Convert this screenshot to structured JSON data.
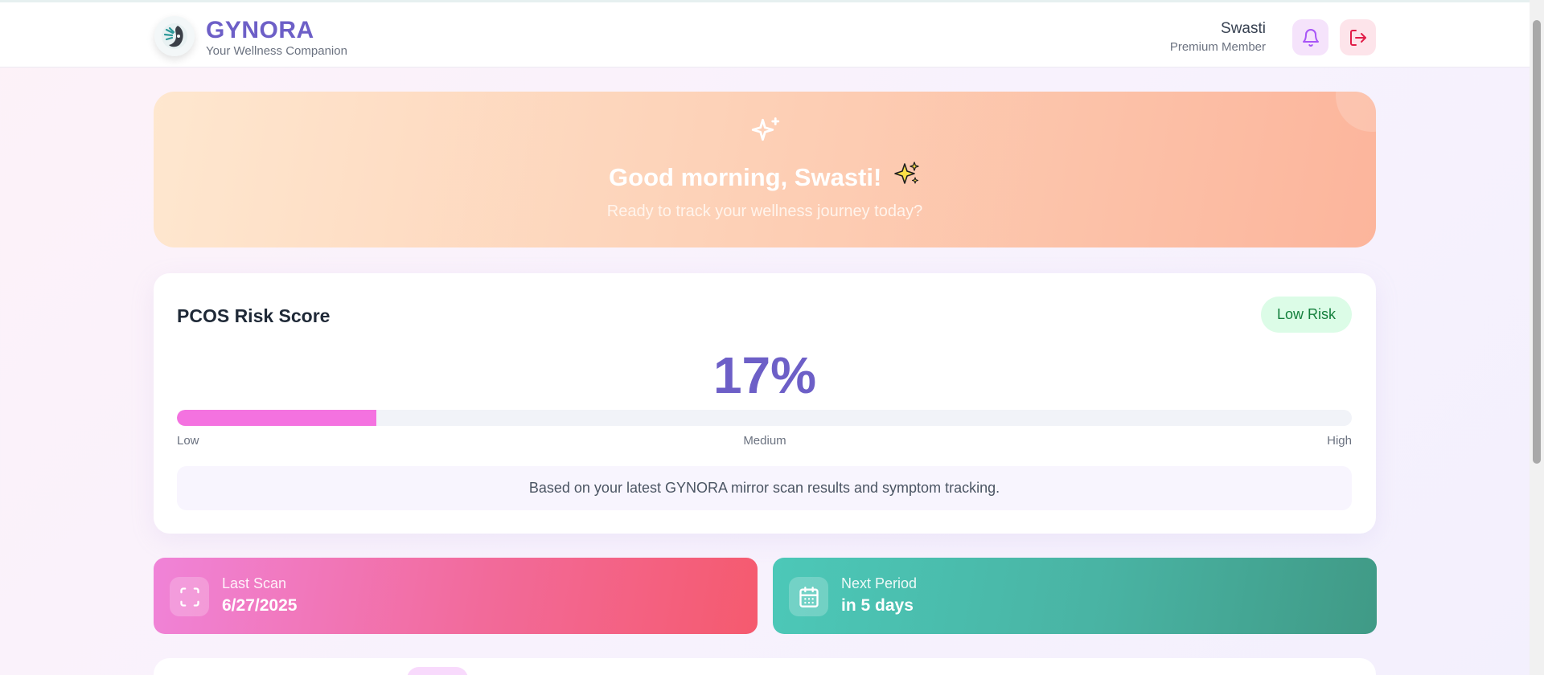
{
  "header": {
    "brand_title": "GYNORA",
    "brand_subtitle": "Your Wellness Companion",
    "user_name": "Swasti",
    "user_tier": "Premium Member",
    "notifications_icon": "bell-icon",
    "logout_icon": "logout-icon"
  },
  "hero": {
    "greeting": "Good morning, Swasti!",
    "emoji": "✨",
    "subtitle": "Ready to track your wellness journey today?"
  },
  "risk": {
    "title": "PCOS Risk Score",
    "badge": "Low Risk",
    "score_text": "17%",
    "score_fraction": 0.17,
    "scale_low": "Low",
    "scale_medium": "Medium",
    "scale_high": "High",
    "note": "Based on your latest GYNORA mirror scan results and symptom tracking."
  },
  "stats": {
    "last_scan_label": "Last Scan",
    "last_scan_value": "6/27/2025",
    "next_period_label": "Next Period",
    "next_period_value": "in 5 days"
  },
  "colors": {
    "brand": "#6d5fc7",
    "risk_fill": "#f472e0",
    "low_risk_bg": "#dcfce7",
    "low_risk_text": "#15803d"
  }
}
